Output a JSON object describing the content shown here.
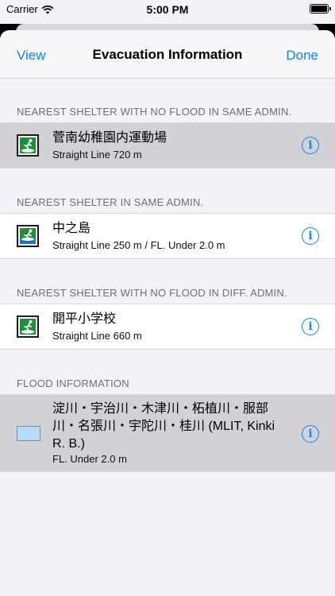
{
  "status": {
    "carrier": "Carrier",
    "time": "5:00 PM"
  },
  "nav": {
    "left": "View",
    "title": "Evacuation Information",
    "right": "Done"
  },
  "sections": [
    {
      "header": "NEAREST SHELTER WITH NO FLOOD IN SAME ADMIN.",
      "title": "菅南幼稚園内運動場",
      "subtitle": "Straight Line 720 m"
    },
    {
      "header": "NEAREST SHELTER IN SAME ADMIN.",
      "title": "中之島",
      "subtitle": "Straight Line 250 m / FL. Under 2.0 m"
    },
    {
      "header": "NEAREST SHELTER WITH NO FLOOD IN DIFF. ADMIN.",
      "title": "開平小学校",
      "subtitle": "Straight Line 660 m"
    },
    {
      "header": "FLOOD INFORMATION",
      "title_lines": [
        "淀川・宇治川・木津川・柘植川・服部",
        "川・名張川・宇陀川・桂川 (MLIT, Kinki",
        "R. B.)"
      ],
      "subtitle": "FL. Under 2.0 m"
    }
  ],
  "colors": {
    "accent": "#0a84ff",
    "flood_swatch": "#b3dcff",
    "shelter_green": "#1f8f3a"
  },
  "icons": {
    "shelter": "evacuation-shelter-icon",
    "info": "info-circle-icon"
  }
}
